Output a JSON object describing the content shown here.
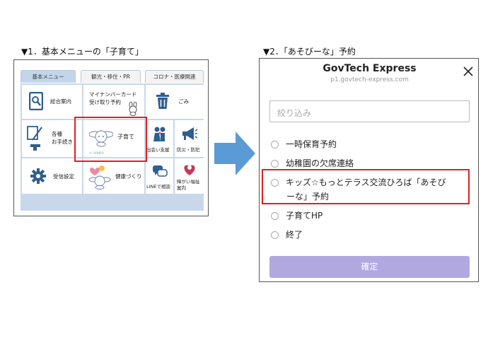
{
  "captions": {
    "left": "▼1．基本メニューの「子育て」",
    "right": "▼2．「あそびーな」予約"
  },
  "left_menu": {
    "tabs": [
      "基本メニュー",
      "観光・移住・PR",
      "コロナ・医療関連"
    ],
    "active_tab": 0,
    "items": {
      "general": "総合案内",
      "mynumber_line1": "マイナンバーカード",
      "mynumber_line2": "受け取り予約",
      "garbage": "ごみ",
      "procedures_line1": "各種",
      "procedures_line2": "お手続き",
      "childcare": "子育て",
      "childcare_footer": "© SANRIO",
      "encounter": "出会い支援",
      "disaster": "防災・防犯",
      "reception": "受信設定",
      "health": "健康づくり",
      "line_consult": "LINEで相談",
      "disability_line1": "障がい福祉",
      "disability_line2": "案内"
    }
  },
  "dialog": {
    "title": "GovTech Express",
    "subtitle": "p1.govtech-express.com",
    "filter_placeholder": "絞り込み",
    "options": [
      "一時保育予約",
      "幼稚園の欠席連絡",
      "キッズ☆もっとテラス交流ひろば「あそび",
      "ーな」予約",
      "子育てHP",
      "終了"
    ],
    "confirm_label": "確定"
  },
  "colors": {
    "highlight": "#e02020",
    "menu_border": "#c8d8ea",
    "icon_blue": "#2f5f8f",
    "confirm_button": "#b2a8e0",
    "arrow": "#5b9bd5"
  }
}
